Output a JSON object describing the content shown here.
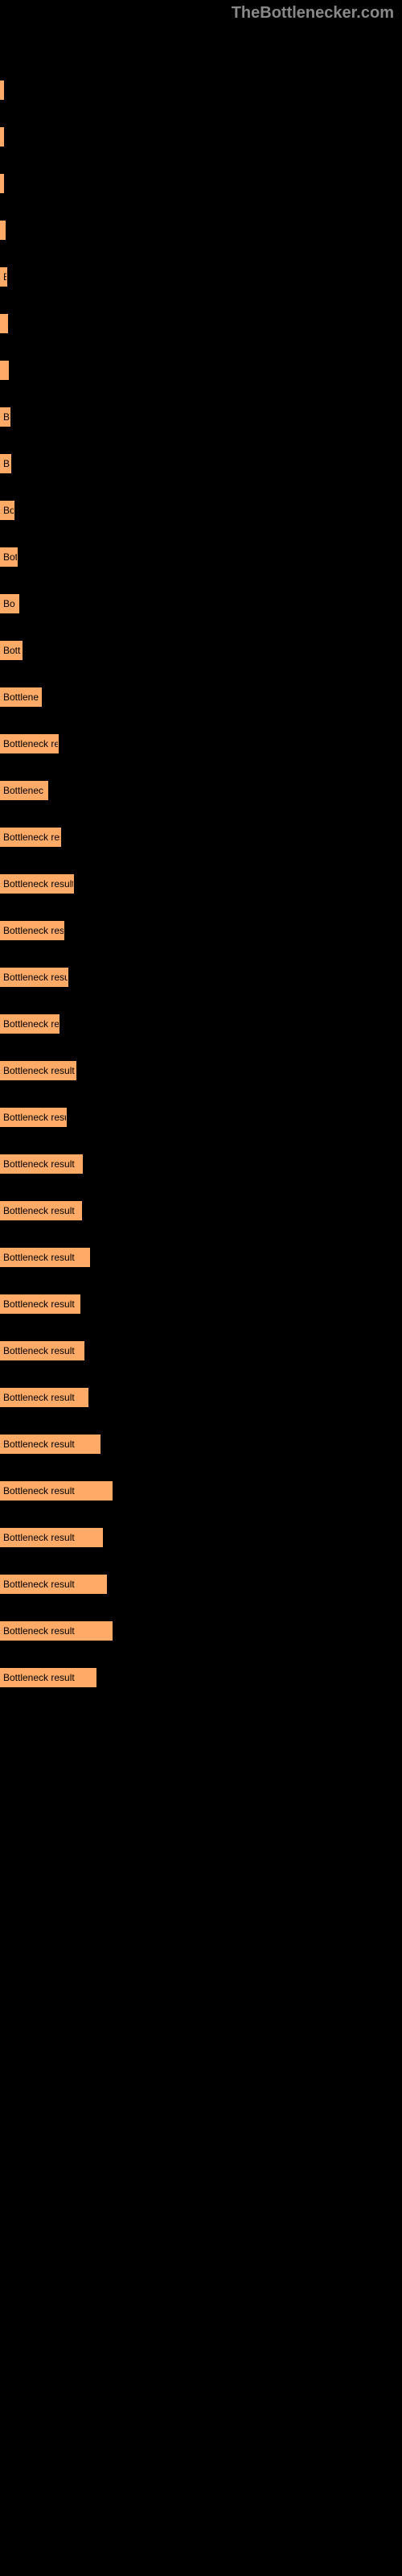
{
  "watermark": "TheBottlenecker.com",
  "chart_data": {
    "type": "bar",
    "title": "",
    "xlabel": "",
    "ylabel": "",
    "bars": [
      {
        "label": "",
        "width": 2
      },
      {
        "label": "",
        "width": 4
      },
      {
        "label": "",
        "width": 5
      },
      {
        "label": "",
        "width": 7
      },
      {
        "label": "B",
        "width": 9
      },
      {
        "label": "",
        "width": 10
      },
      {
        "label": "",
        "width": 11
      },
      {
        "label": "B",
        "width": 13
      },
      {
        "label": "B",
        "width": 14
      },
      {
        "label": "Bo",
        "width": 18
      },
      {
        "label": "Bot",
        "width": 22
      },
      {
        "label": "Bo",
        "width": 24
      },
      {
        "label": "Bott",
        "width": 28
      },
      {
        "label": "Bottlene",
        "width": 52
      },
      {
        "label": "Bottleneck re",
        "width": 73
      },
      {
        "label": "Bottlenec",
        "width": 60
      },
      {
        "label": "Bottleneck res",
        "width": 76
      },
      {
        "label": "Bottleneck result",
        "width": 92
      },
      {
        "label": "Bottleneck res",
        "width": 80
      },
      {
        "label": "Bottleneck resu",
        "width": 85
      },
      {
        "label": "Bottleneck re",
        "width": 74
      },
      {
        "label": "Bottleneck result",
        "width": 95
      },
      {
        "label": "Bottleneck resu",
        "width": 83
      },
      {
        "label": "Bottleneck result",
        "width": 103
      },
      {
        "label": "Bottleneck result",
        "width": 102
      },
      {
        "label": "Bottleneck result",
        "width": 112
      },
      {
        "label": "Bottleneck result",
        "width": 100
      },
      {
        "label": "Bottleneck result",
        "width": 105
      },
      {
        "label": "Bottleneck result",
        "width": 110
      },
      {
        "label": "Bottleneck result",
        "width": 125
      },
      {
        "label": "Bottleneck result",
        "width": 140
      },
      {
        "label": "Bottleneck result",
        "width": 128
      },
      {
        "label": "Bottleneck result",
        "width": 133
      },
      {
        "label": "Bottleneck result",
        "width": 140
      },
      {
        "label": "Bottleneck result",
        "width": 120
      }
    ]
  }
}
